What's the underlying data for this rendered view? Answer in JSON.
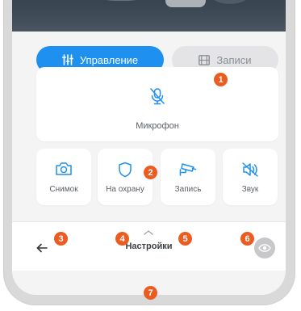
{
  "tabs": {
    "control_label": "Управление",
    "records_label": "Записи"
  },
  "controls": {
    "microphone_label": "Микрофон",
    "snapshot_label": "Снимок",
    "arm_label": "На охрану",
    "record_label": "Запись",
    "sound_label": "Звук"
  },
  "bottom_bar": {
    "settings_label": "Настройки"
  },
  "callouts": [
    "1",
    "2",
    "3",
    "4",
    "5",
    "6",
    "7"
  ],
  "colors": {
    "accent": "#1e90f0",
    "callout": "#ec5b1f",
    "background": "#f4f4f5",
    "inactive_tab": "#e4e4e6"
  },
  "icons": {
    "control": "sliders-icon",
    "records": "film-icon",
    "microphone": "microphone-muted-icon",
    "snapshot": "camera-icon",
    "arm": "shield-icon",
    "record": "cctv-camera-icon",
    "sound": "speaker-muted-icon",
    "back": "arrow-left-icon",
    "expand": "chevron-up-icon",
    "visibility": "eye-icon",
    "fullscreen": "fullscreen-icon"
  }
}
